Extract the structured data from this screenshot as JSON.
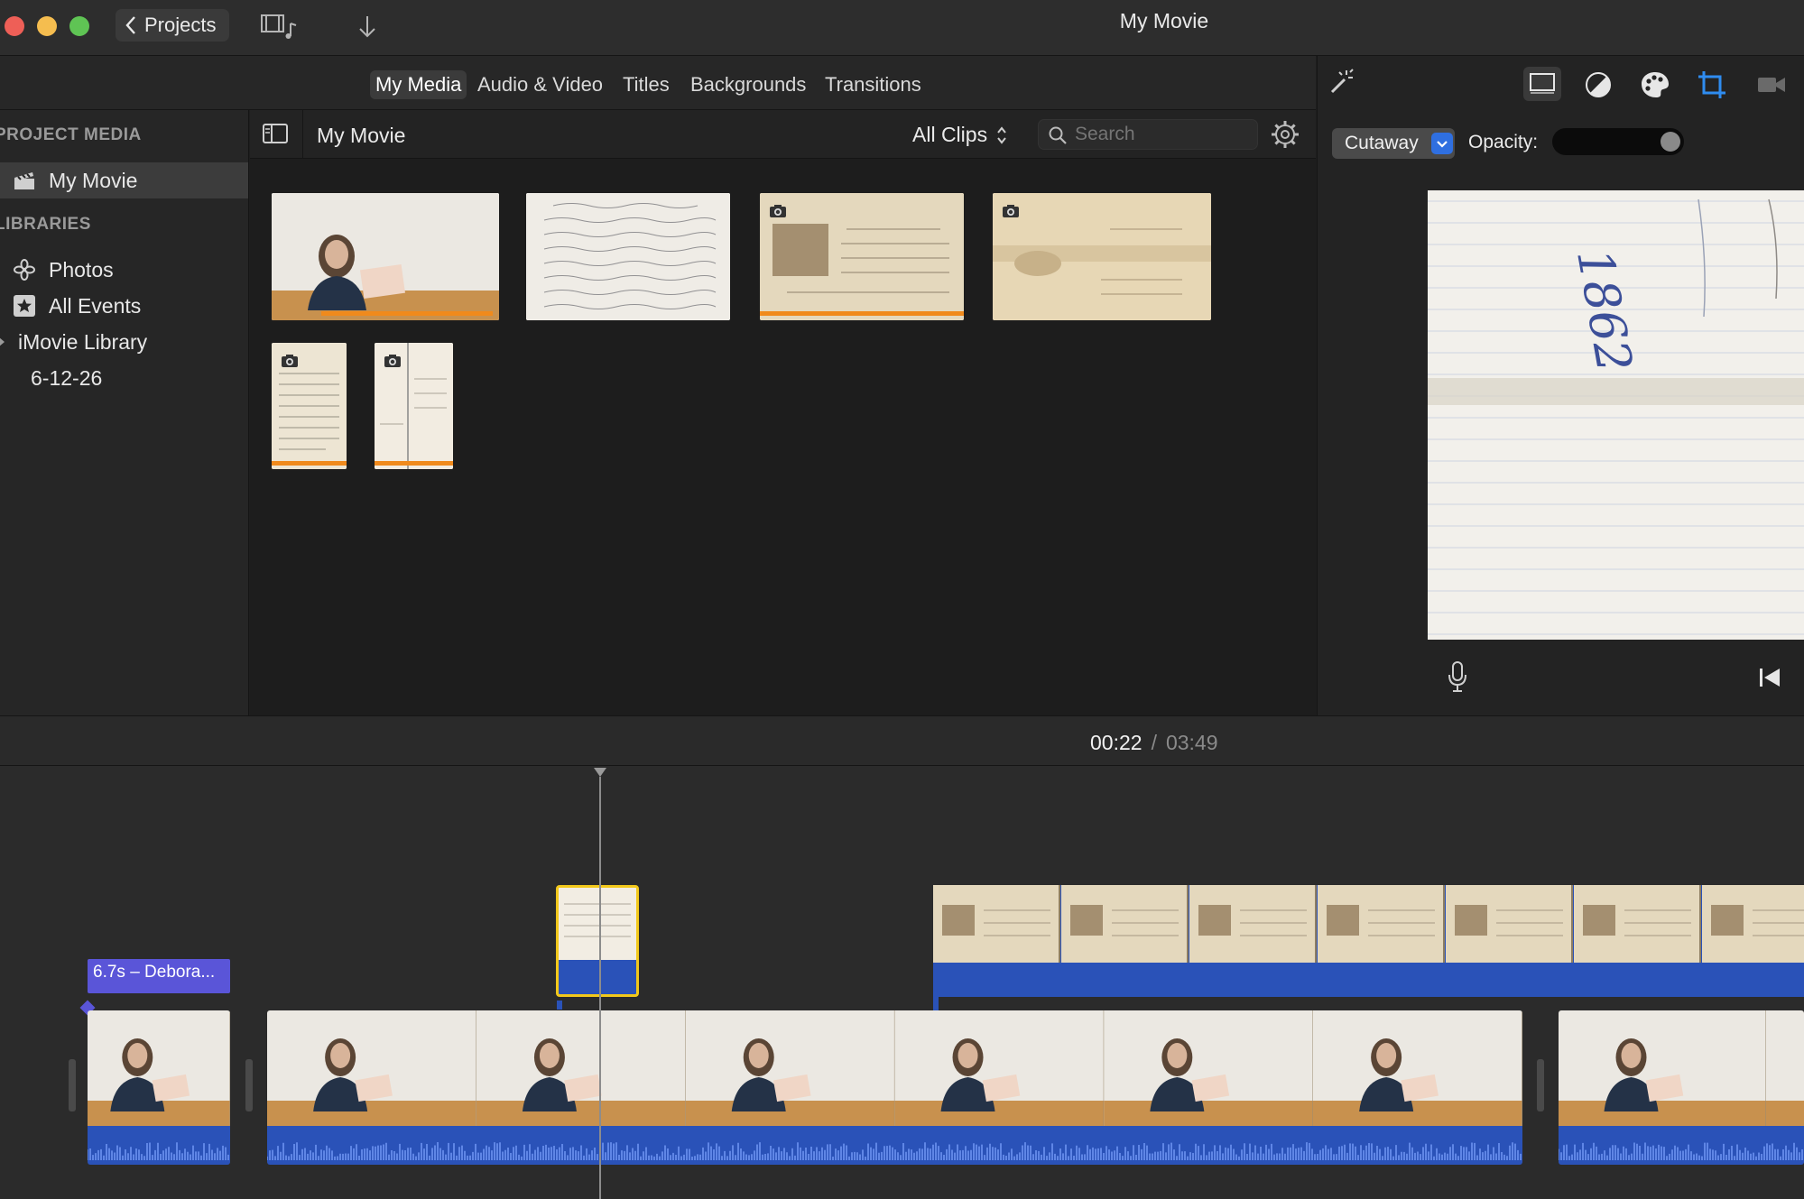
{
  "window": {
    "title": "My Movie"
  },
  "toolbar": {
    "projects_label": "Projects"
  },
  "browser_tabs": [
    {
      "label": "My Media",
      "selected": true
    },
    {
      "label": "Audio & Video",
      "selected": false
    },
    {
      "label": "Titles",
      "selected": false
    },
    {
      "label": "Backgrounds",
      "selected": false
    },
    {
      "label": "Transitions",
      "selected": false
    }
  ],
  "sidebar": {
    "project_media_header": "PROJECT MEDIA",
    "project_item": "My Movie",
    "libraries_header": "LIBRARIES",
    "items": [
      {
        "label": "Photos",
        "icon": "photos-icon"
      },
      {
        "label": "All Events",
        "icon": "star-icon"
      },
      {
        "label": "iMovie Library",
        "icon": "disclosure-icon"
      },
      {
        "label": "6-12-26",
        "icon": ""
      }
    ]
  },
  "browser": {
    "title": "My Movie",
    "filter_label": "All Clips",
    "search_placeholder": "Search"
  },
  "viewer": {
    "overlay_mode": "Cutaway",
    "opacity_label": "Opacity:",
    "opacity_value": 1.0,
    "handwriting_sample": "1862"
  },
  "timeline": {
    "current_time": "00:22",
    "separator": "/",
    "total_time": "03:49",
    "title_clip_label": "6.7s – Debora..."
  },
  "colors": {
    "accent_blue": "#2f6fe0",
    "selection_yellow": "#f2c81b",
    "audio_blue": "#2a52b8",
    "title_purple": "#5a55d8",
    "progress_orange": "#f08a1c"
  }
}
